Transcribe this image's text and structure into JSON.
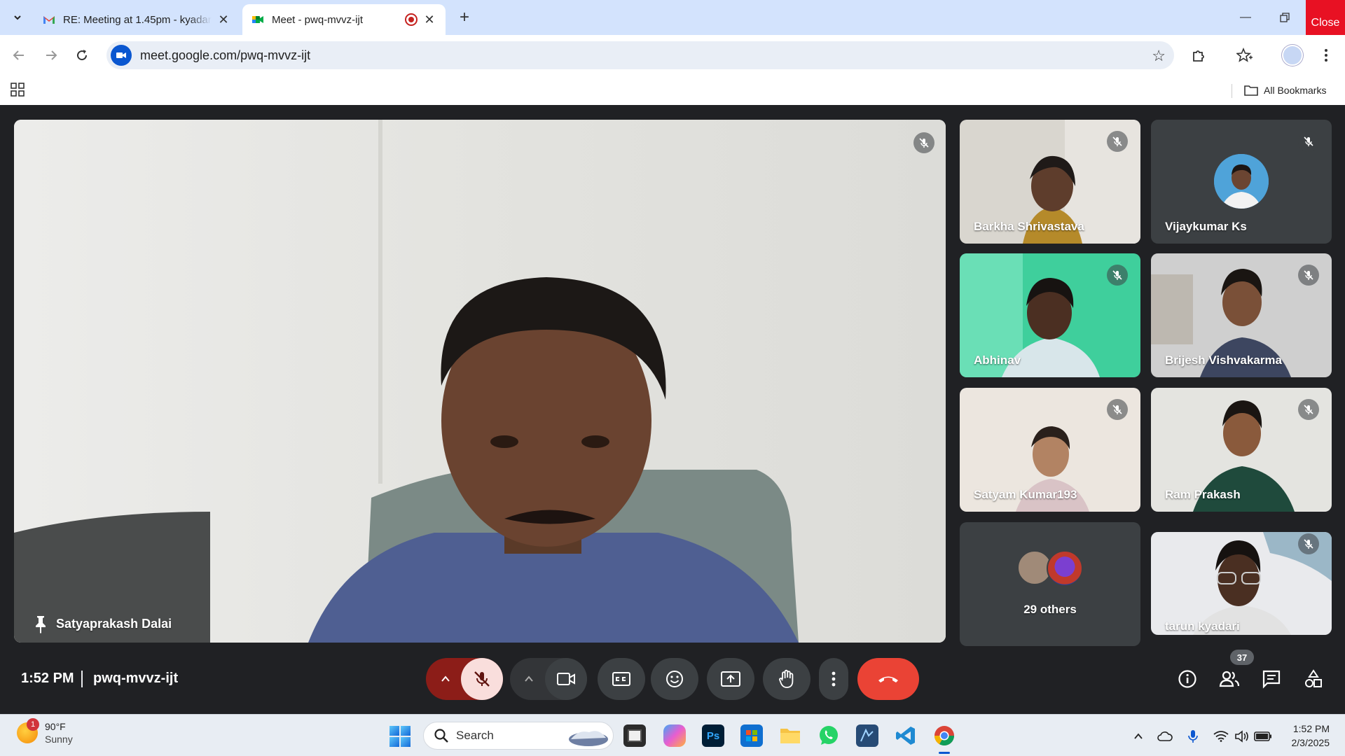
{
  "browser": {
    "tabs": [
      {
        "title": "RE: Meeting at 1.45pm - kyadari",
        "active": false
      },
      {
        "title": "Meet - pwq-mvvz-ijt",
        "active": true
      }
    ],
    "close_label": "Close",
    "url": "meet.google.com/pwq-mvvz-ijt",
    "bookmarks_label": "All Bookmarks"
  },
  "meet": {
    "main_participant": "Satyaprakash Dalai",
    "participants": [
      {
        "name": "Barkha Shrivastava"
      },
      {
        "name": "Vijaykumar Ks"
      },
      {
        "name": "Abhinav"
      },
      {
        "name": "Brijesh Vishvakarma"
      },
      {
        "name": "Satyam Kumar193"
      },
      {
        "name": "Ram Prakash"
      },
      {
        "name": "29 others"
      },
      {
        "name": "tarun kyadari"
      }
    ],
    "time": "1:52 PM",
    "meeting_code": "pwq-mvvz-ijt",
    "people_count": "37",
    "colors": {
      "end_call": "#ea4335",
      "mic_off_bg": "#f9dedc",
      "mic_group": "#8c1d18"
    }
  },
  "taskbar": {
    "weather_temp": "90°F",
    "weather_cond": "Sunny",
    "weather_badge": "1",
    "search_label": "Search",
    "time": "1:52 PM",
    "date": "2/3/2025",
    "apps": [
      "file-explorer-icon",
      "copilot-icon",
      "photoshop-icon",
      "store-icon",
      "folder-icon",
      "whatsapp-icon",
      "app-icon",
      "vscode-icon",
      "chrome-icon"
    ]
  }
}
